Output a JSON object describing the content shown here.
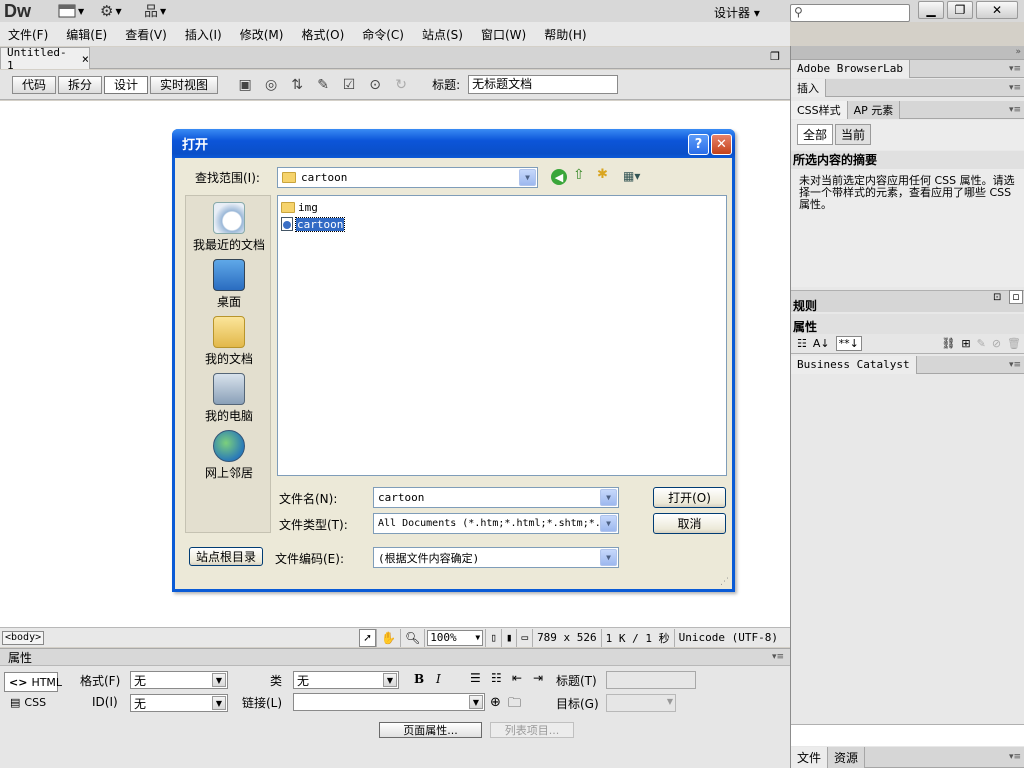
{
  "app": {
    "logo": "Dw",
    "workspace": "设计器 ▾"
  },
  "menu": [
    "文件(F)",
    "编辑(E)",
    "查看(V)",
    "插入(I)",
    "修改(M)",
    "格式(O)",
    "命令(C)",
    "站点(S)",
    "窗口(W)",
    "帮助(H)"
  ],
  "document": {
    "tab_label": "Untitled-1",
    "close_glyph": "×",
    "view_buttons": [
      "代码",
      "拆分",
      "设计",
      "实时视图"
    ],
    "title_label": "标题:",
    "title_value": "无标题文档"
  },
  "statusbar": {
    "tag": "<body>",
    "zoom": "100%",
    "size": "789 x 526",
    "filesize": "1 K / 1 秒",
    "encoding": "Unicode (UTF-8)"
  },
  "properties": {
    "title": "属性",
    "html_button": "HTML",
    "css_button": "CSS",
    "format_label": "格式(F)",
    "format_value": "无",
    "id_label": "ID(I)",
    "id_value": "无",
    "class_label": "类",
    "class_value": "无",
    "link_label": "链接(L)",
    "title_label": "标题(T)",
    "target_label": "目标(G)",
    "page_props_button": "页面属性...",
    "list_items_button": "列表项目..."
  },
  "panels": {
    "browserlab": "Adobe BrowserLab",
    "insert": "插入",
    "css_tab": "CSS样式",
    "ap_tab": "AP 元素",
    "all_button": "全部",
    "current_button": "当前",
    "summary_title": "所选内容的摘要",
    "summary_text": "未对当前选定内容应用任何 CSS 属性。请选择一个带样式的元素，查看应用了哪些 CSS 属性。",
    "rules_title": "规则",
    "props_title": "属性",
    "business_catalyst": "Business Catalyst",
    "files_tab": "文件",
    "assets_tab": "资源"
  },
  "dialog": {
    "title": "打开",
    "look_in_label": "查找范围(I):",
    "look_in_value": "cartoon",
    "places": [
      "我最近的文档",
      "桌面",
      "我的文档",
      "我的电脑",
      "网上邻居"
    ],
    "files": [
      {
        "name": "img",
        "type": "folder",
        "selected": false
      },
      {
        "name": "cartoon",
        "type": "html",
        "selected": true
      }
    ],
    "filename_label": "文件名(N):",
    "filename_value": "cartoon",
    "filetype_label": "文件类型(T):",
    "filetype_value": "All Documents (*.htm;*.html;*.shtm;*.",
    "encoding_label": "文件编码(E):",
    "encoding_value": "(根据文件内容确定)",
    "site_root_button": "站点根目录",
    "open_button": "打开(O)",
    "cancel_button": "取消"
  },
  "colors": {
    "dialog_title": "#0a55d6",
    "selection": "#316ac5"
  }
}
